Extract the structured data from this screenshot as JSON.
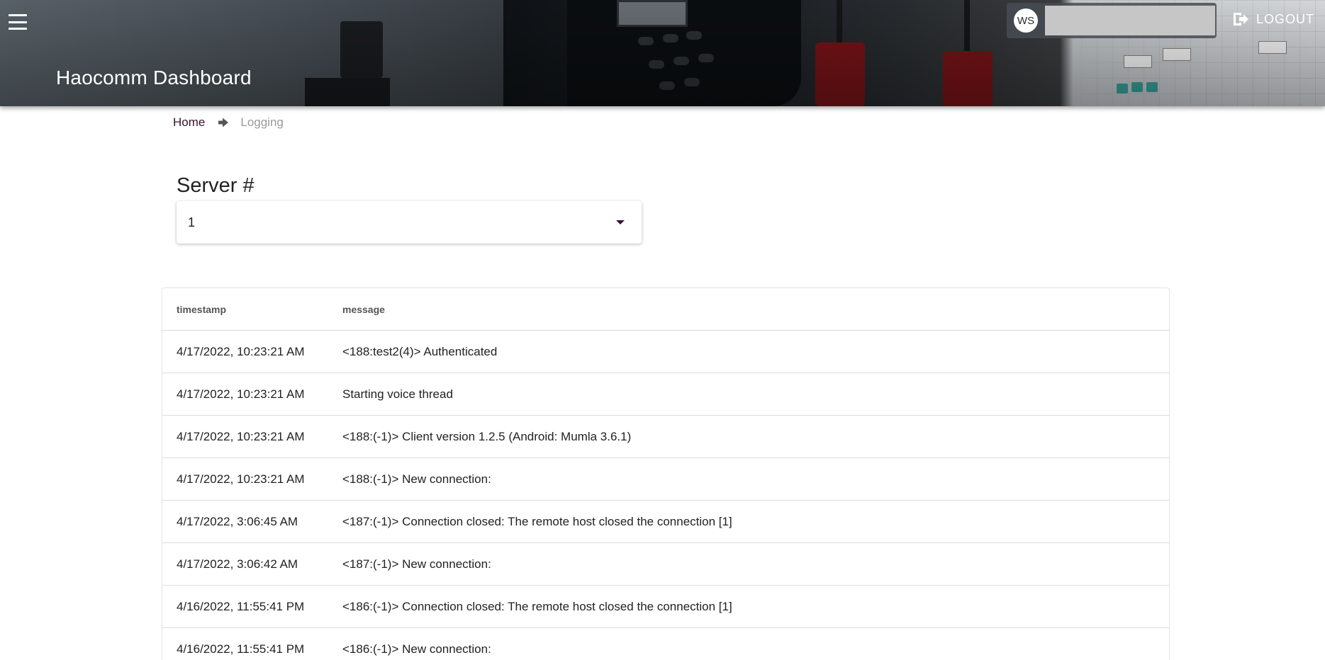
{
  "header": {
    "title": "Haocomm Dashboard",
    "avatar_initials": "WS",
    "logout_label": "LOGOUT",
    "menu_icon": "hamburger-menu-icon",
    "logout_icon": "logout-icon"
  },
  "breadcrumb": {
    "home": "Home",
    "separator_icon": "arrow-right-icon",
    "current": "Logging"
  },
  "server": {
    "label": "Server #",
    "selected": "1"
  },
  "log_table": {
    "columns": [
      "timestamp",
      "message"
    ],
    "rows": [
      {
        "timestamp": "4/17/2022, 10:23:21 AM",
        "message": "<188:test2(4)> Authenticated"
      },
      {
        "timestamp": "4/17/2022, 10:23:21 AM",
        "message": "Starting voice thread"
      },
      {
        "timestamp": "4/17/2022, 10:23:21 AM",
        "message": "<188:(-1)> Client version 1.2.5 (Android: Mumla 3.6.1)"
      },
      {
        "timestamp": "4/17/2022, 10:23:21 AM",
        "message": "<188:(-1)> New connection:"
      },
      {
        "timestamp": "4/17/2022, 3:06:45 AM",
        "message": "<187:(-1)> Connection closed: The remote host closed the connection [1]"
      },
      {
        "timestamp": "4/17/2022, 3:06:42 AM",
        "message": "<187:(-1)> New connection:"
      },
      {
        "timestamp": "4/16/2022, 11:55:41 PM",
        "message": "<186:(-1)> Connection closed: The remote host closed the connection [1]"
      },
      {
        "timestamp": "4/16/2022, 11:55:41 PM",
        "message": "<186:(-1)> New connection:"
      }
    ]
  },
  "colors": {
    "accent": "#3b1230",
    "muted_text": "#9a9a9a"
  }
}
